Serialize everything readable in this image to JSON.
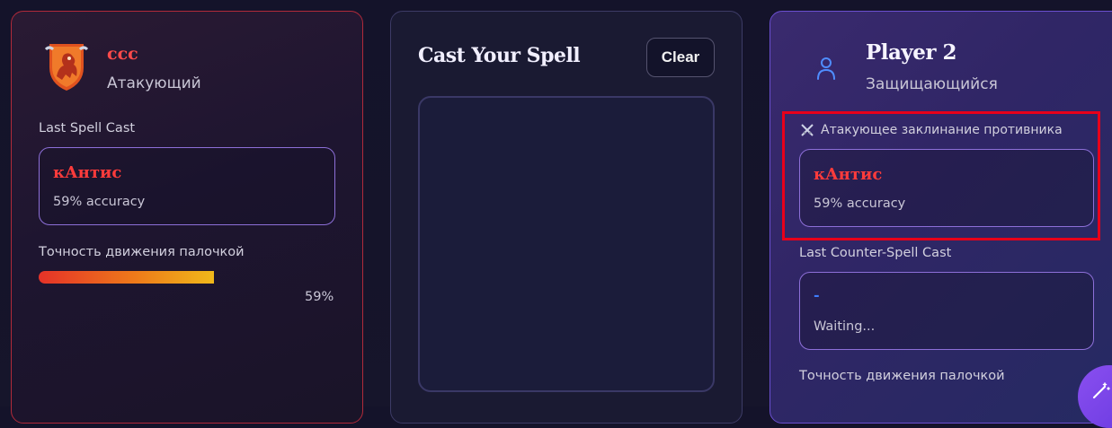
{
  "attacker": {
    "name": "ccc",
    "role": "Атакующий",
    "last_spell_label": "Last Spell Cast",
    "spell_name": "кАнтис",
    "accuracy_text": "59% accuracy",
    "wand_label": "Точность движения палочкой",
    "wand_accuracy_percent": 59,
    "wand_accuracy_text": "59%",
    "crest_icon": "lion-crest-icon"
  },
  "cast_panel": {
    "title": "Cast Your Spell",
    "clear_label": "Clear"
  },
  "defender": {
    "name": "Player 2",
    "role": "Защищающийся",
    "user_icon": "user-icon",
    "opponent_spell_label": "Атакующее заклинание противника",
    "opponent_spell_icon": "crossed-swords-icon",
    "opponent_spell_name": "кАнтис",
    "opponent_accuracy_text": "59% accuracy",
    "counter_label": "Last Counter-Spell Cast",
    "counter_spell_name": "-",
    "counter_status": "Waiting...",
    "wand_label": "Точность движения палочкой"
  },
  "fab": {
    "icon": "magic-wand-icon"
  },
  "colors": {
    "attacker_accent": "#ff4a4a",
    "defender_accent": "#6b4fd0",
    "highlight": "#e8001a",
    "bar_start": "#e53228",
    "bar_end": "#f0b81a"
  }
}
